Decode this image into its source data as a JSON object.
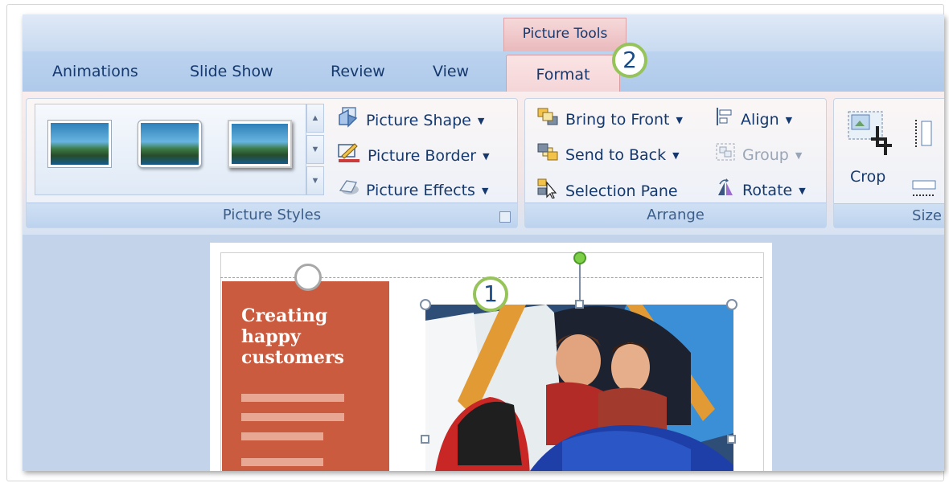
{
  "contextual_tab": {
    "label": "Picture Tools"
  },
  "tabs": [
    {
      "label": "Animations"
    },
    {
      "label": "Slide Show"
    },
    {
      "label": "Review"
    },
    {
      "label": "View"
    },
    {
      "label": "Format",
      "selected": true
    }
  ],
  "callouts": {
    "one": "1",
    "two": "2"
  },
  "picture_styles": {
    "label": "Picture Styles",
    "commands": {
      "shape": "Picture Shape",
      "border": "Picture Border",
      "effects": "Picture Effects"
    }
  },
  "arrange": {
    "label": "Arrange",
    "commands": {
      "bring_to_front": "Bring to Front",
      "send_to_back": "Send to Back",
      "selection_pane": "Selection Pane",
      "align": "Align",
      "group": "Group",
      "rotate": "Rotate"
    }
  },
  "size": {
    "label": "Size",
    "crop": "Crop"
  },
  "slide": {
    "title": "Creating happy customers"
  },
  "colors": {
    "accent_panel": "#cb5b3e",
    "callout_ring": "#96c35a",
    "contextual_tab": "#eab9bc"
  }
}
